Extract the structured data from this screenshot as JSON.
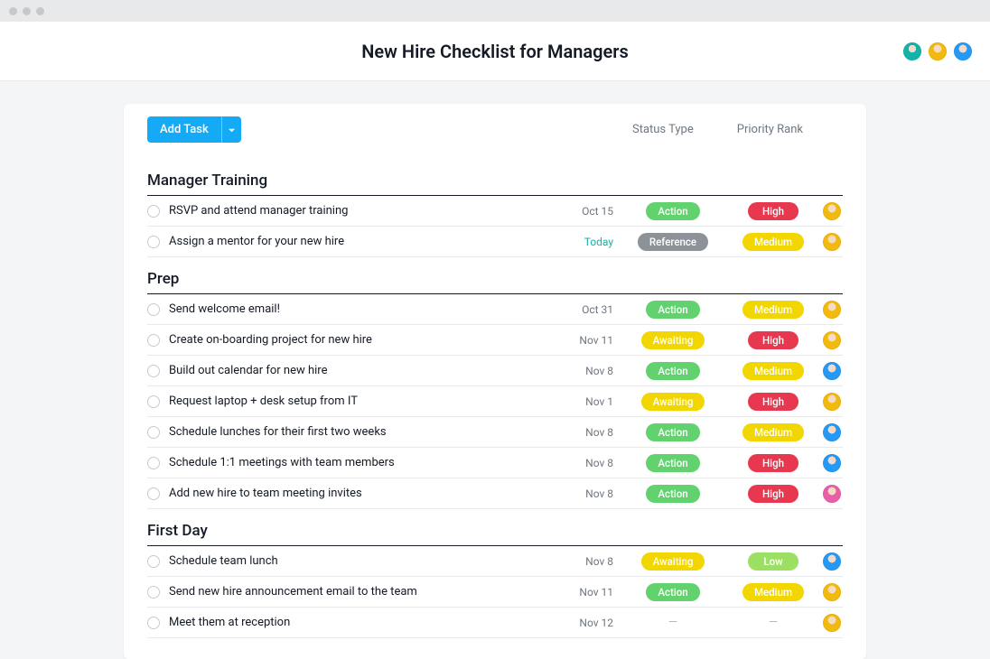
{
  "header": {
    "title": "New Hire Checklist for Managers",
    "avatars": [
      "teal",
      "yellow",
      "blue"
    ]
  },
  "toolbar": {
    "add_task_label": "Add Task"
  },
  "columns": {
    "status": "Status Type",
    "priority": "Priority Rank"
  },
  "sections": [
    {
      "title": "Manager Training",
      "tasks": [
        {
          "title": "RSVP and attend manager training",
          "date": "Oct 15",
          "date_today": false,
          "status": "Action",
          "status_class": "action",
          "priority": "High",
          "priority_class": "high",
          "assignee": "yellow"
        },
        {
          "title": "Assign a mentor for your new hire",
          "date": "Today",
          "date_today": true,
          "status": "Reference",
          "status_class": "reference",
          "priority": "Medium",
          "priority_class": "medium",
          "assignee": "yellow"
        }
      ]
    },
    {
      "title": "Prep",
      "tasks": [
        {
          "title": "Send welcome email!",
          "date": "Oct 31",
          "date_today": false,
          "status": "Action",
          "status_class": "action",
          "priority": "Medium",
          "priority_class": "medium",
          "assignee": "yellow"
        },
        {
          "title": "Create on-boarding project for new hire",
          "date": "Nov 11",
          "date_today": false,
          "status": "Awaiting",
          "status_class": "awaiting",
          "priority": "High",
          "priority_class": "high",
          "assignee": "yellow"
        },
        {
          "title": "Build out calendar for new hire",
          "date": "Nov 8",
          "date_today": false,
          "status": "Action",
          "status_class": "action",
          "priority": "Medium",
          "priority_class": "medium",
          "assignee": "blue"
        },
        {
          "title": "Request laptop + desk setup from IT",
          "date": "Nov 1",
          "date_today": false,
          "status": "Awaiting",
          "status_class": "awaiting",
          "priority": "High",
          "priority_class": "high",
          "assignee": "yellow"
        },
        {
          "title": "Schedule lunches for their first two weeks",
          "date": "Nov 8",
          "date_today": false,
          "status": "Action",
          "status_class": "action",
          "priority": "Medium",
          "priority_class": "medium",
          "assignee": "blue"
        },
        {
          "title": "Schedule 1:1 meetings with team members",
          "date": "Nov 8",
          "date_today": false,
          "status": "Action",
          "status_class": "action",
          "priority": "High",
          "priority_class": "high",
          "assignee": "blue"
        },
        {
          "title": "Add new hire to team meeting invites",
          "date": "Nov 8",
          "date_today": false,
          "status": "Action",
          "status_class": "action",
          "priority": "High",
          "priority_class": "high",
          "assignee": "pink"
        }
      ]
    },
    {
      "title": "First Day",
      "tasks": [
        {
          "title": "Schedule team lunch",
          "date": "Nov 8",
          "date_today": false,
          "status": "Awaiting",
          "status_class": "awaiting",
          "priority": "Low",
          "priority_class": "low",
          "assignee": "blue"
        },
        {
          "title": "Send new hire announcement email to the team",
          "date": "Nov 11",
          "date_today": false,
          "status": "Action",
          "status_class": "action",
          "priority": "Medium",
          "priority_class": "medium",
          "assignee": "yellow"
        },
        {
          "title": "Meet them at reception",
          "date": "Nov 12",
          "date_today": false,
          "status": "",
          "status_class": "",
          "priority": "",
          "priority_class": "",
          "assignee": "yellow"
        }
      ]
    }
  ]
}
